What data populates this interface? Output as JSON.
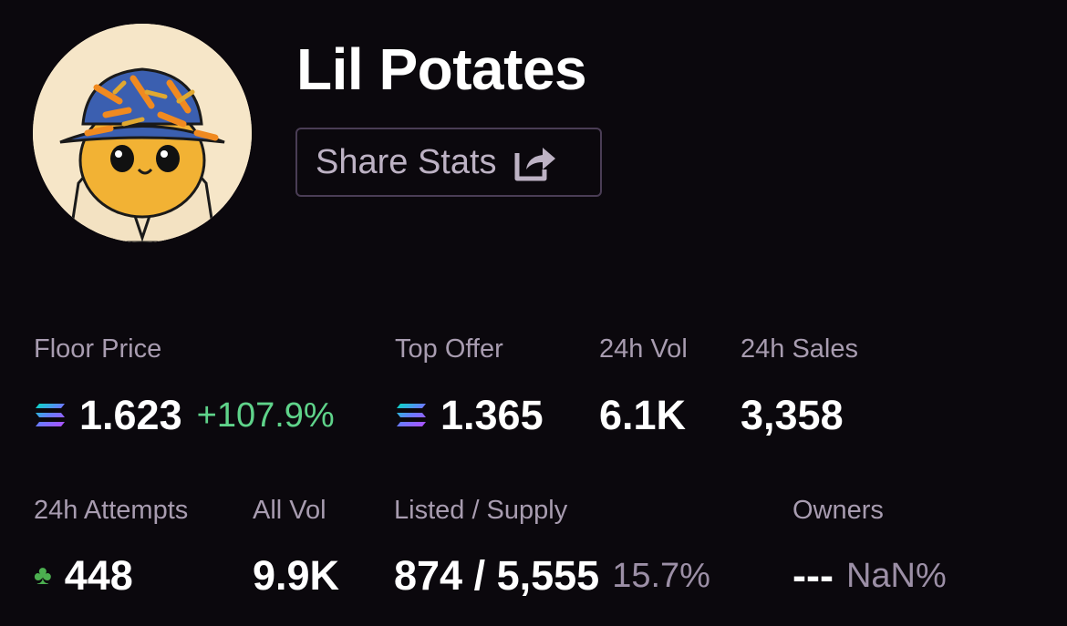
{
  "collection": {
    "name": "Lil Potates",
    "share_label": "Share Stats"
  },
  "icons": {
    "avatar": "potato-with-bucket-hat",
    "share": "share-icon",
    "currency": "solana-icon",
    "attempts": "clover-icon"
  },
  "colors": {
    "background": "#0b080d",
    "positive": "#5fd38a",
    "muted": "#9c8fa6"
  },
  "stats": {
    "floor_price": {
      "label": "Floor Price",
      "value": "1.623",
      "change": "+107.9%"
    },
    "top_offer": {
      "label": "Top Offer",
      "value": "1.365"
    },
    "vol_24h": {
      "label": "24h Vol",
      "value": "6.1K"
    },
    "sales_24h": {
      "label": "24h Sales",
      "value": "3,358"
    },
    "attempts_24h": {
      "label": "24h Attempts",
      "value": "448"
    },
    "all_vol": {
      "label": "All Vol",
      "value": "9.9K"
    },
    "listed_supply": {
      "label": "Listed / Supply",
      "value": "874 / 5,555",
      "percent": "15.7%"
    },
    "owners": {
      "label": "Owners",
      "value": "---",
      "percent": "NaN%"
    }
  }
}
